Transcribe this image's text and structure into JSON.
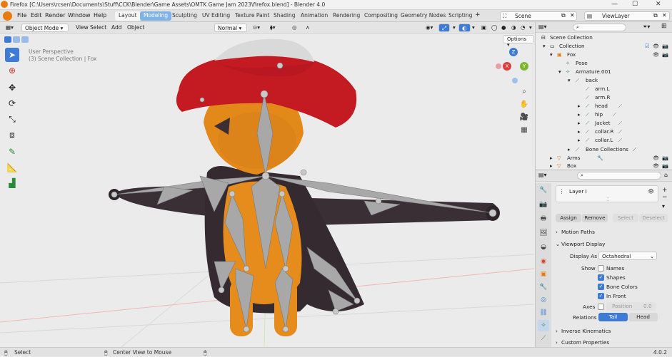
{
  "window": {
    "title": "Firefox [C:\\Users\\rcsen\\Documents\\Stuff\\CCK\\Blender\\Game Assets\\OMTK Game Jam 2023\\firefox.blend] - Blender 4.0",
    "min": "—",
    "max": "☐",
    "close": "✕"
  },
  "menu": [
    "File",
    "Edit",
    "Render",
    "Window",
    "Help"
  ],
  "workspaces": [
    "Layout",
    "Modeling",
    "Sculpting",
    "UV Editing",
    "Texture Paint",
    "Shading",
    "Animation",
    "Rendering",
    "Compositing",
    "Geometry Nodes",
    "Scripting"
  ],
  "active_workspace": "Modeling",
  "scene": {
    "label": "Scene",
    "view_layer": "ViewLayer"
  },
  "header": {
    "mode": "Object Mode",
    "view_menus": [
      "View",
      "Select",
      "Add",
      "Object"
    ],
    "orientation": "Normal",
    "options": "Options"
  },
  "viewport": {
    "perspective": "User Perspective",
    "context": "(3) Scene Collection | Fox",
    "gizmo_axes": [
      "Z",
      "Y",
      "X"
    ]
  },
  "outliner": {
    "rows": [
      {
        "label": "Scene Collection"
      },
      {
        "label": "Collection"
      },
      {
        "label": "Fox"
      },
      {
        "label": "Pose"
      },
      {
        "label": "Armature.001"
      },
      {
        "label": "back"
      },
      {
        "label": "arm.L"
      },
      {
        "label": "arm.R"
      },
      {
        "label": "head"
      },
      {
        "label": "hip"
      },
      {
        "label": "Jacket"
      },
      {
        "label": "collar.R"
      },
      {
        "label": "collar.L"
      },
      {
        "label": "Bone Collections"
      },
      {
        "label": "Arms"
      },
      {
        "label": "Box"
      }
    ]
  },
  "properties": {
    "layer": "Layer I",
    "assign": "Assign",
    "remove": "Remove",
    "select": "Select",
    "deselect": "Deselect",
    "motion_paths": "Motion Paths",
    "viewport_display": "Viewport Display",
    "display_as_label": "Display As",
    "display_as": "Octahedral",
    "show_label": "Show",
    "names": "Names",
    "shapes": "Shapes",
    "bone_colors": "Bone Colors",
    "in_front": "In Front",
    "axes_label": "Axes",
    "position_label": "Position",
    "position_value": "0.0",
    "relations_label": "Relations",
    "tail": "Tail",
    "head": "Head",
    "inverse_kinematics": "Inverse Kinematics",
    "custom_properties": "Custom Properties"
  },
  "status": {
    "select": "Select",
    "center": "Center View to Mouse",
    "version": "4.0.2"
  }
}
